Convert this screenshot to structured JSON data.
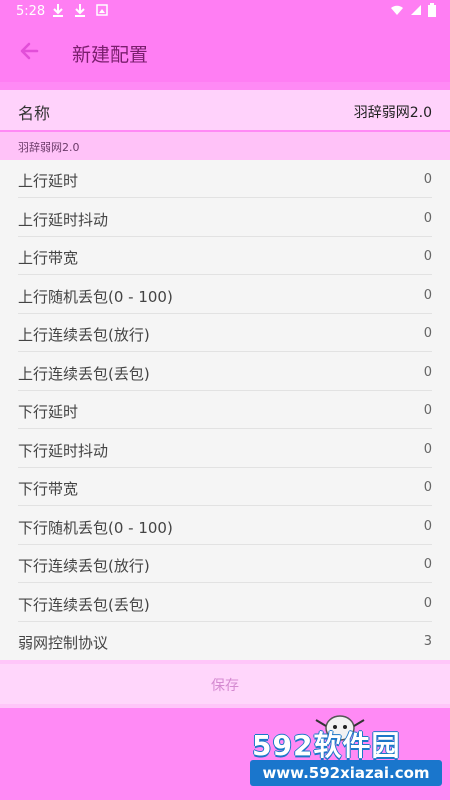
{
  "status_bar": {
    "time": "5:28",
    "notifications": [
      "download-icon",
      "download-icon",
      "image-icon"
    ],
    "system_icons": [
      "wifi-icon",
      "signal-icon",
      "battery-icon"
    ]
  },
  "app_bar": {
    "back_icon": "arrow-left-icon",
    "title": "新建配置"
  },
  "name_field": {
    "label": "名称",
    "value": "羽辞弱网2.0"
  },
  "section": {
    "label": "羽辞弱网2.0"
  },
  "settings": [
    {
      "label": "上行延时",
      "value": "0"
    },
    {
      "label": "上行延时抖动",
      "value": "0"
    },
    {
      "label": "上行带宽",
      "value": "0"
    },
    {
      "label": "上行随机丢包(0 - 100)",
      "value": "0"
    },
    {
      "label": "上行连续丢包(放行)",
      "value": "0"
    },
    {
      "label": "上行连续丢包(丢包)",
      "value": "0"
    },
    {
      "label": "下行延时",
      "value": "0"
    },
    {
      "label": "下行延时抖动",
      "value": "0"
    },
    {
      "label": "下行带宽",
      "value": "0"
    },
    {
      "label": "下行随机丢包(0 - 100)",
      "value": "0"
    },
    {
      "label": "下行连续丢包(放行)",
      "value": "0"
    },
    {
      "label": "下行连续丢包(丢包)",
      "value": "0"
    },
    {
      "label": "弱网控制协议",
      "value": "3"
    }
  ],
  "save_button": {
    "label": "保存"
  },
  "watermark": {
    "brand": "592软件园",
    "url": "www.592xiazai.com"
  },
  "colors": {
    "accent": "#ff7ef3",
    "back_arrow": "#e24fd8",
    "list_bg": "#f5f5f5"
  }
}
